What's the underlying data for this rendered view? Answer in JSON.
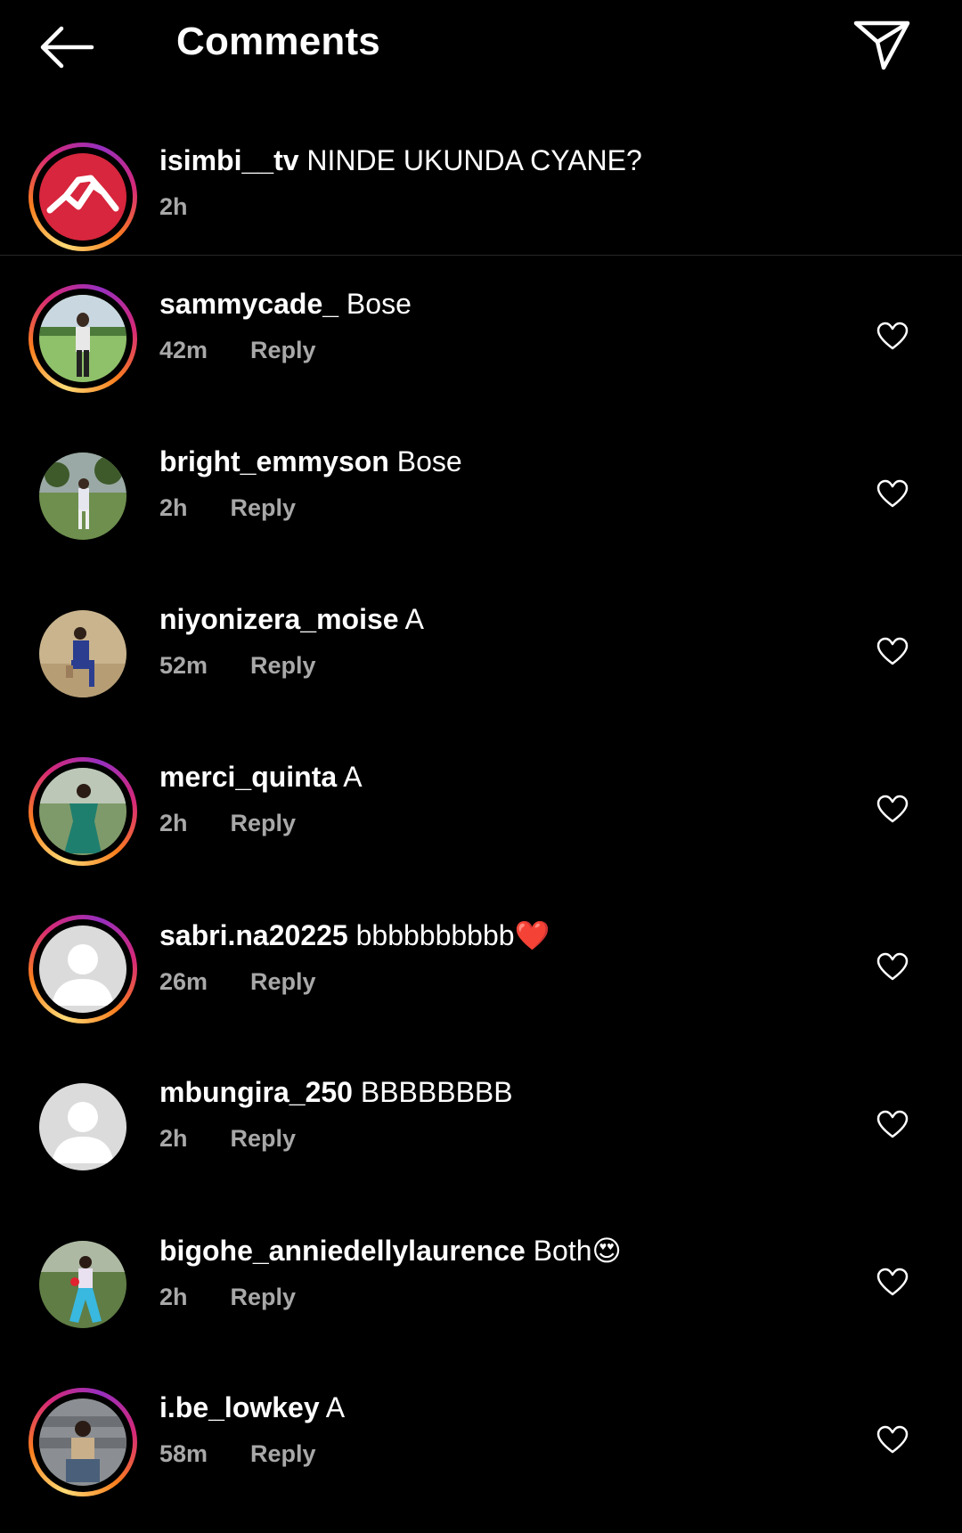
{
  "header": {
    "title": "Comments",
    "back_icon": "arrow-left-icon",
    "send_icon": "paper-plane-icon"
  },
  "caption": {
    "username": "isimbi__tv",
    "text": "NINDE UKUNDA CYANE?",
    "time": "2h"
  },
  "reply_label": "Reply",
  "comments": [
    {
      "username": "sammycade_",
      "text": "Bose",
      "time": "42m",
      "story_ring": true
    },
    {
      "username": "bright_emmyson",
      "text": "Bose",
      "time": "2h",
      "story_ring": false
    },
    {
      "username": "niyonizera_moise",
      "text": "A",
      "time": "52m",
      "story_ring": false
    },
    {
      "username": "merci_quinta",
      "text": "A",
      "time": "2h",
      "story_ring": true
    },
    {
      "username": "sabri.na20225",
      "text": "bbbbbbbbbb❤️",
      "time": "26m",
      "story_ring": true
    },
    {
      "username": "mbungira_250",
      "text": "BBBBBBBB",
      "time": "2h",
      "story_ring": false
    },
    {
      "username": "bigohe_anniedellylaurence",
      "text": "Both😍",
      "time": "2h",
      "story_ring": false
    },
    {
      "username": "i.be_lowkey",
      "text": "A",
      "time": "58m",
      "story_ring": true
    }
  ],
  "colors": {
    "background": "#000000",
    "secondary_text": "#a8a8a8",
    "caption_avatar": "#d7263d"
  }
}
